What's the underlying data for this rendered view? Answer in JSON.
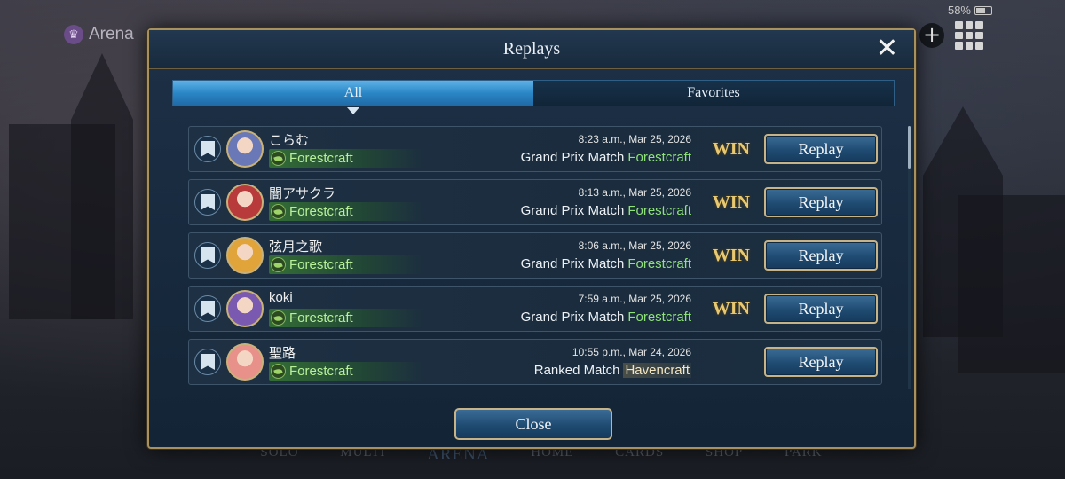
{
  "background": {
    "arena_label": "Arena",
    "battery": "58%",
    "nav": [
      "SOLO",
      "MULTI",
      "ARENA",
      "HOME",
      "CARDS",
      "SHOP",
      "PARK"
    ],
    "nav_active": "ARENA"
  },
  "modal": {
    "title": "Replays",
    "close_label": "Close",
    "tabs": [
      {
        "label": "All",
        "active": true
      },
      {
        "label": "Favorites",
        "active": false
      }
    ],
    "replay_label": "Replay",
    "rows": [
      {
        "name": "こらむ",
        "class": "Forestcraft",
        "time": "8:23 a.m., Mar 25, 2026",
        "match": "Grand Prix Match",
        "opp_class": "Forestcraft",
        "result": "WIN",
        "avatar_color": "#6a78b8"
      },
      {
        "name": "闇アサクラ",
        "class": "Forestcraft",
        "time": "8:13 a.m., Mar 25, 2026",
        "match": "Grand Prix Match",
        "opp_class": "Forestcraft",
        "result": "WIN",
        "avatar_color": "#b83a3a"
      },
      {
        "name": "弦月之歌",
        "class": "Forestcraft",
        "time": "8:06 a.m., Mar 25, 2026",
        "match": "Grand Prix Match",
        "opp_class": "Forestcraft",
        "result": "WIN",
        "avatar_color": "#e0a43a"
      },
      {
        "name": "koki",
        "class": "Forestcraft",
        "time": "7:59 a.m., Mar 25, 2026",
        "match": "Grand Prix Match",
        "opp_class": "Forestcraft",
        "result": "WIN",
        "avatar_color": "#7a5ab0"
      },
      {
        "name": "聖路",
        "class": "Forestcraft",
        "time": "10:55 p.m., Mar 24, 2026",
        "match": "Ranked Match",
        "opp_class": "Havencraft",
        "result": "",
        "avatar_color": "#e8908a"
      }
    ]
  },
  "colors": {
    "accent_gold": "#c7b386",
    "forest_green": "#8fe27a",
    "win_gold": "#e8c870"
  }
}
